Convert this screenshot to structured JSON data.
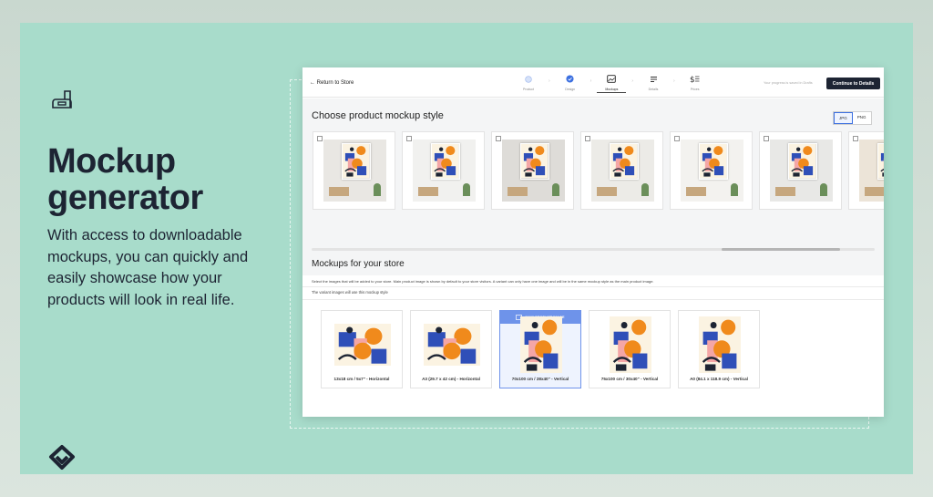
{
  "hero": {
    "headline": "Mockup generator",
    "description": "With access to downloadable mockups, you can quickly and easily showcase how your products will look in real life."
  },
  "app": {
    "return_label": "← Return to Store",
    "steps": [
      {
        "label": "Product",
        "icon": "info-icon",
        "state": "done"
      },
      {
        "label": "Design",
        "icon": "check-icon",
        "state": "done"
      },
      {
        "label": "Mockups",
        "icon": "image-icon",
        "state": "active"
      },
      {
        "label": "Details",
        "icon": "lines-icon",
        "state": "todo"
      },
      {
        "label": "Prices",
        "icon": "dollar-list-icon",
        "state": "todo"
      }
    ],
    "progress_note": "Your progress is saved in Drafts",
    "continue_label": "Continue to Details",
    "mockup_heading": "Choose product mockup style",
    "format_options": [
      "JPG",
      "PNG"
    ],
    "format_selected": "JPG",
    "mockup_styles": [
      "style-1",
      "style-2",
      "style-3",
      "style-4",
      "style-5",
      "style-6",
      "style-7"
    ],
    "store_heading": "Mockups for your store",
    "store_info": "Select the images that will be added to your store. Main product image is shown by default to your store visitors. A variant can only have one image and will be in the same mockup style as the main product image.",
    "variant_info": "The variant images will use this mockup style",
    "main_badge": "MAIN PRODUCT IMAGE",
    "sizes": [
      {
        "label": "13x18 cm / 5x7\" - Horizontal",
        "orientation": "horizontal",
        "main": false
      },
      {
        "label": "A3 (29.7 x 42 cm) - Horizontal",
        "orientation": "horizontal",
        "main": false
      },
      {
        "label": "70x100 cm / 28x40\" - Vertical",
        "orientation": "vertical",
        "main": true
      },
      {
        "label": "75x100 cm / 30x40\" - Vertical",
        "orientation": "vertical",
        "main": false
      },
      {
        "label": "A0 (84.1 x 118.9 cm) - Vertical",
        "orientation": "vertical",
        "main": false
      }
    ]
  },
  "colors": {
    "background": "#a8dccb",
    "text": "#1d2433",
    "accent_blue": "#6e93ea",
    "button": "#1d2433"
  }
}
